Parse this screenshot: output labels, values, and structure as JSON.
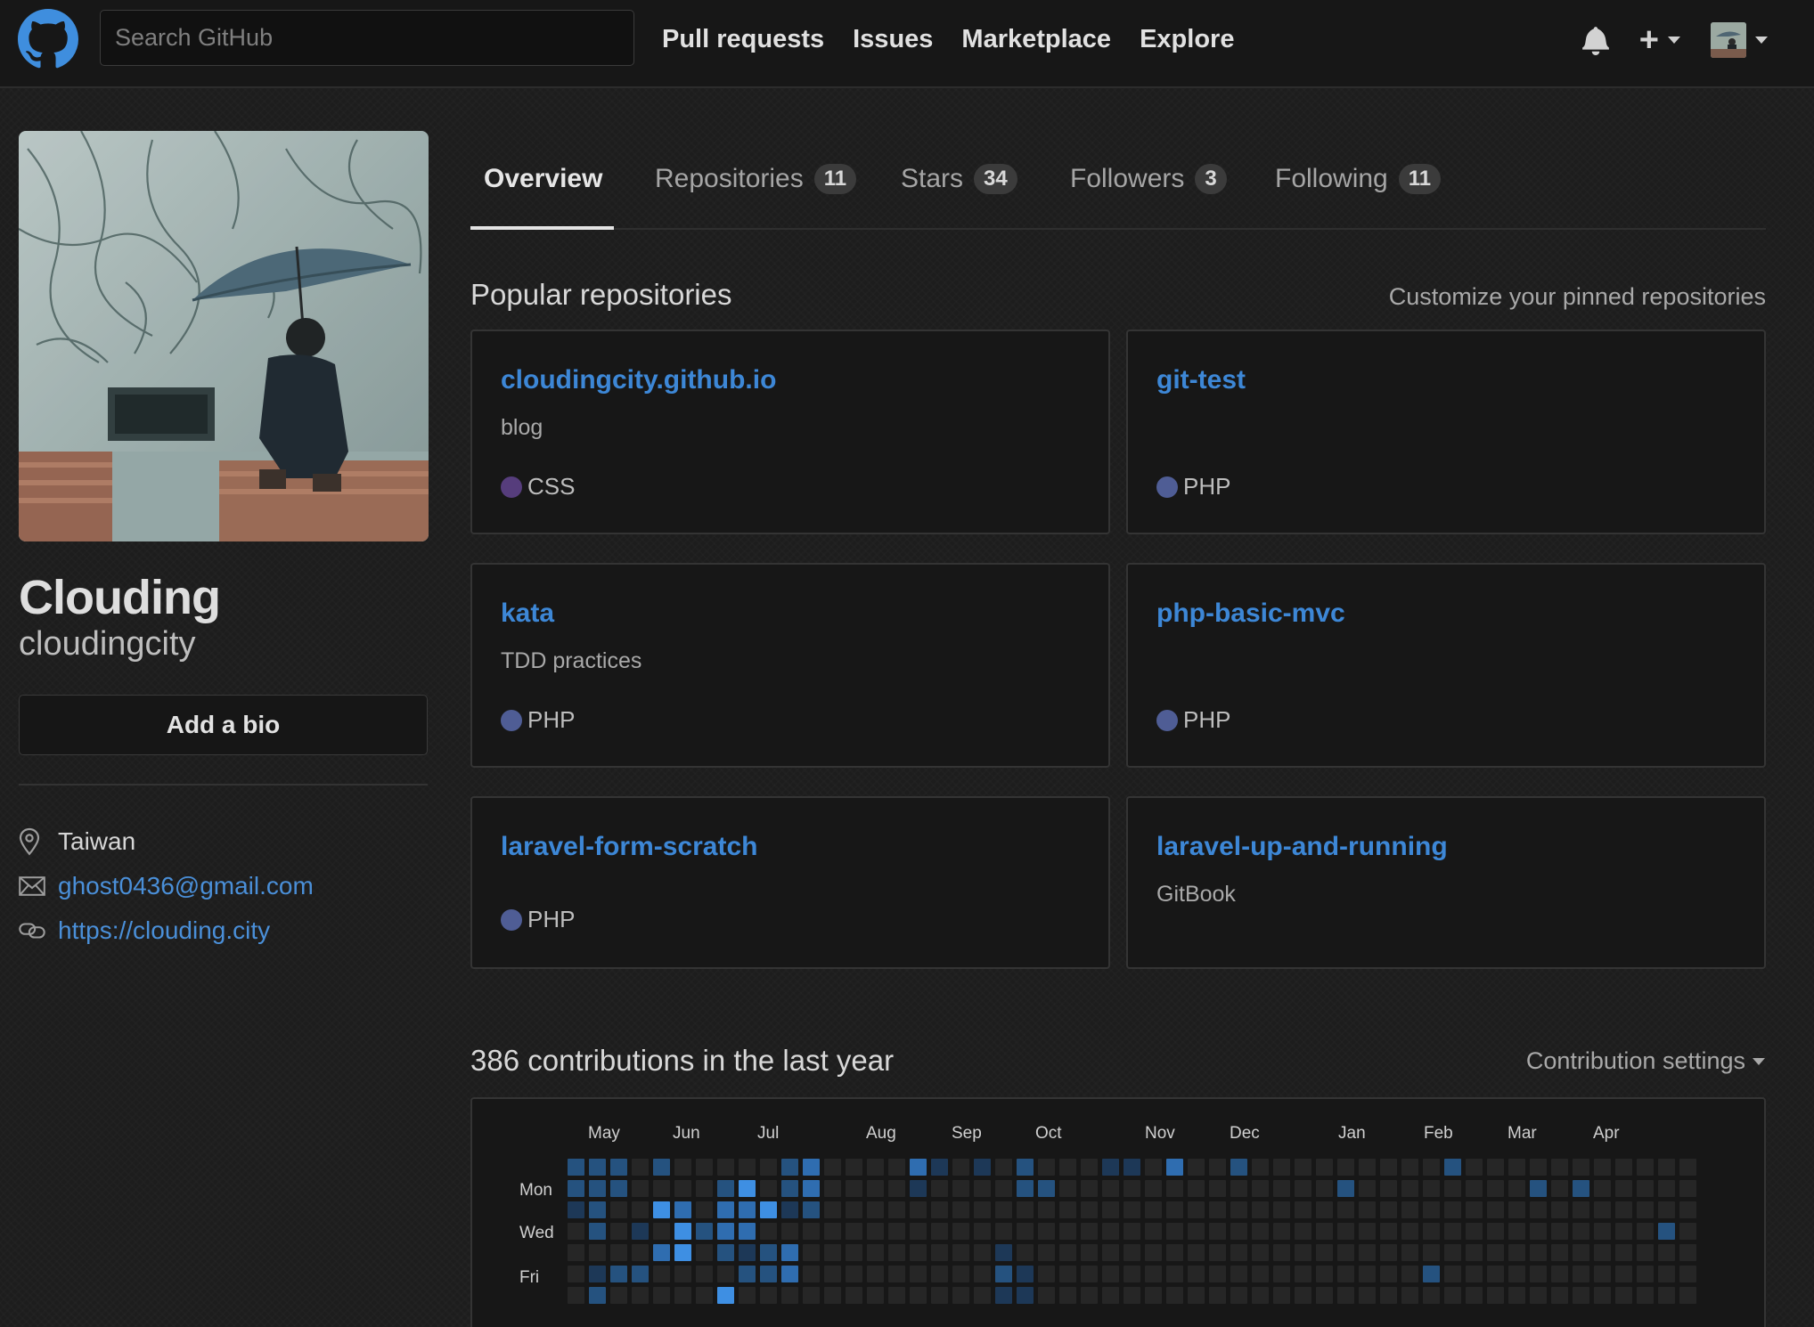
{
  "header": {
    "search_placeholder": "Search GitHub",
    "nav": [
      "Pull requests",
      "Issues",
      "Marketplace",
      "Explore"
    ],
    "plus_label": "+"
  },
  "profile": {
    "name": "Clouding",
    "login": "cloudingcity",
    "bio_button": "Add a bio",
    "location": "Taiwan",
    "email": "ghost0436@gmail.com",
    "website": "https://clouding.city"
  },
  "tabs": [
    {
      "label": "Overview",
      "count": null,
      "selected": true
    },
    {
      "label": "Repositories",
      "count": "11"
    },
    {
      "label": "Stars",
      "count": "34"
    },
    {
      "label": "Followers",
      "count": "3"
    },
    {
      "label": "Following",
      "count": "11"
    }
  ],
  "popular": {
    "title": "Popular repositories",
    "customize": "Customize your pinned repositories",
    "repos": [
      {
        "name": "cloudingcity.github.io",
        "description": "blog",
        "language": "CSS",
        "color": "#563d7c"
      },
      {
        "name": "git-test",
        "description": "",
        "language": "PHP",
        "color": "#4f5d95"
      },
      {
        "name": "kata",
        "description": "TDD practices",
        "language": "PHP",
        "color": "#4f5d95"
      },
      {
        "name": "php-basic-mvc",
        "description": "",
        "language": "PHP",
        "color": "#4f5d95"
      },
      {
        "name": "laravel-form-scratch",
        "description": "",
        "language": "PHP",
        "color": "#4f5d95"
      },
      {
        "name": "laravel-up-and-running",
        "description": "GitBook",
        "language": "",
        "color": ""
      }
    ]
  },
  "contributions": {
    "title": "386 contributions in the last year",
    "settings": "Contribution settings",
    "months": [
      "May",
      "Jun",
      "Jul",
      "Aug",
      "Sep",
      "Oct",
      "Nov",
      "Dec",
      "Jan",
      "Feb",
      "Mar",
      "Apr"
    ],
    "day_labels": [
      "Mon",
      "Wed",
      "Fri"
    ],
    "level_colors": [
      "#262626",
      "#1d3857",
      "#25527f",
      "#2f6db0",
      "#3e8fe3"
    ],
    "weeks": [
      [
        2,
        2,
        1,
        0,
        0,
        0,
        0
      ],
      [
        2,
        2,
        2,
        2,
        0,
        1,
        2
      ],
      [
        2,
        2,
        0,
        0,
        0,
        2,
        0
      ],
      [
        0,
        0,
        0,
        1,
        0,
        2,
        0
      ],
      [
        2,
        0,
        4,
        0,
        3,
        0,
        0
      ],
      [
        0,
        0,
        3,
        4,
        4,
        0,
        0
      ],
      [
        0,
        0,
        0,
        2,
        0,
        0,
        0
      ],
      [
        0,
        2,
        3,
        3,
        2,
        0,
        4
      ],
      [
        0,
        4,
        3,
        3,
        1,
        2,
        0
      ],
      [
        0,
        0,
        4,
        0,
        2,
        2,
        0
      ],
      [
        2,
        2,
        1,
        0,
        3,
        3,
        0
      ],
      [
        3,
        3,
        2,
        0,
        0,
        0,
        0
      ],
      [
        0,
        0,
        0,
        0,
        0,
        0,
        0
      ],
      [
        0,
        0,
        0,
        0,
        0,
        0,
        0
      ],
      [
        0,
        0,
        0,
        0,
        0,
        0,
        0
      ],
      [
        0,
        0,
        0,
        0,
        0,
        0,
        0
      ],
      [
        3,
        1,
        0,
        0,
        0,
        0,
        0
      ],
      [
        1,
        0,
        0,
        0,
        0,
        0,
        0
      ],
      [
        0,
        0,
        0,
        0,
        0,
        0,
        0
      ],
      [
        1,
        0,
        0,
        0,
        0,
        0,
        0
      ],
      [
        0,
        0,
        0,
        0,
        1,
        2,
        1
      ],
      [
        2,
        2,
        0,
        0,
        0,
        1,
        1
      ],
      [
        0,
        2,
        0,
        0,
        0,
        0,
        0
      ],
      [
        0,
        0,
        0,
        0,
        0,
        0,
        0
      ],
      [
        0,
        0,
        0,
        0,
        0,
        0,
        0
      ],
      [
        1,
        0,
        0,
        0,
        0,
        0,
        0
      ],
      [
        1,
        0,
        0,
        0,
        0,
        0,
        0
      ],
      [
        0,
        0,
        0,
        0,
        0,
        0,
        0
      ],
      [
        3,
        0,
        0,
        0,
        0,
        0,
        0
      ],
      [
        0,
        0,
        0,
        0,
        0,
        0,
        0
      ],
      [
        0,
        0,
        0,
        0,
        0,
        0,
        0
      ],
      [
        2,
        0,
        0,
        0,
        0,
        0,
        0
      ],
      [
        0,
        0,
        0,
        0,
        0,
        0,
        0
      ],
      [
        0,
        0,
        0,
        0,
        0,
        0,
        0
      ],
      [
        0,
        0,
        0,
        0,
        0,
        0,
        0
      ],
      [
        0,
        0,
        0,
        0,
        0,
        0,
        0
      ],
      [
        0,
        2,
        0,
        0,
        0,
        0,
        0
      ],
      [
        0,
        0,
        0,
        0,
        0,
        0,
        0
      ],
      [
        0,
        0,
        0,
        0,
        0,
        0,
        0
      ],
      [
        0,
        0,
        0,
        0,
        0,
        0,
        0
      ],
      [
        0,
        0,
        0,
        0,
        0,
        2,
        0
      ],
      [
        2,
        0,
        0,
        0,
        0,
        0,
        0
      ],
      [
        0,
        0,
        0,
        0,
        0,
        0,
        0
      ],
      [
        0,
        0,
        0,
        0,
        0,
        0,
        0
      ],
      [
        0,
        0,
        0,
        0,
        0,
        0,
        0
      ],
      [
        0,
        2,
        0,
        0,
        0,
        0,
        0
      ],
      [
        0,
        0,
        0,
        0,
        0,
        0,
        0
      ],
      [
        0,
        2,
        0,
        0,
        0,
        0,
        0
      ],
      [
        0,
        0,
        0,
        0,
        0,
        0,
        0
      ],
      [
        0,
        0,
        0,
        0,
        0,
        0,
        0
      ],
      [
        0,
        0,
        0,
        0,
        0,
        0,
        0
      ],
      [
        0,
        0,
        0,
        2,
        0,
        0,
        0
      ],
      [
        0,
        0,
        0,
        0,
        0,
        0,
        0
      ]
    ]
  }
}
